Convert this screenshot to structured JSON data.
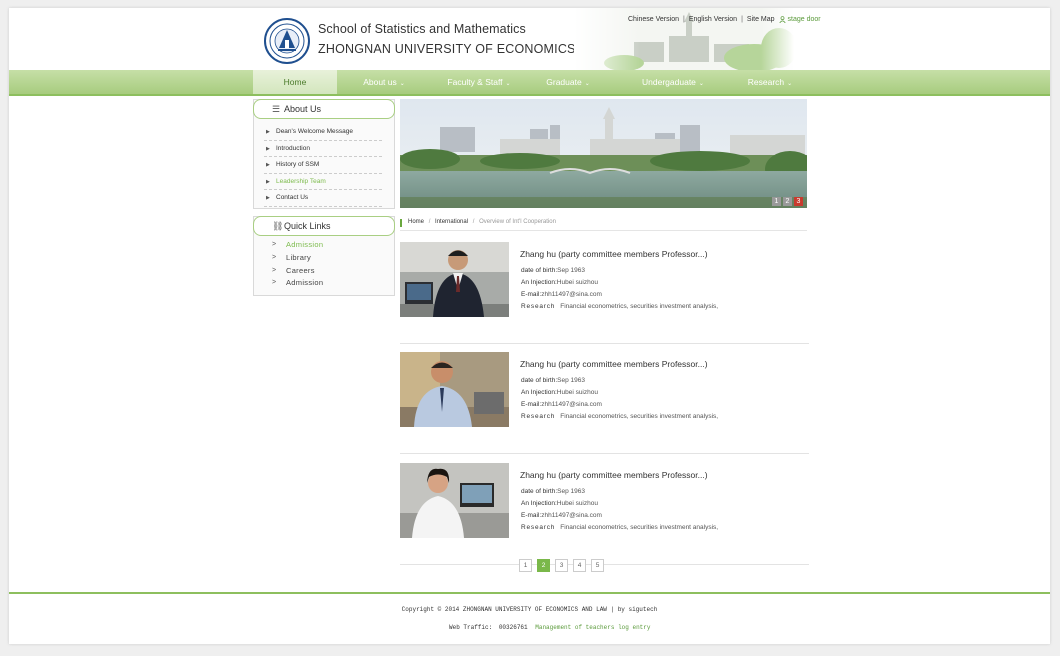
{
  "header": {
    "school": "School of Statistics and Mathematics",
    "university": "ZHONGNAN UNIVERSITY OF ECONOMICS AND LAW",
    "toplinks": [
      "Chinese Version",
      "English Version",
      "Site Map"
    ],
    "stage_door": "stage door"
  },
  "nav": {
    "items": [
      {
        "label": "Home"
      },
      {
        "label": "About us"
      },
      {
        "label": "Faculty & Staff"
      },
      {
        "label": "Graduate"
      },
      {
        "label": "Undergaduate"
      },
      {
        "label": "Research"
      }
    ],
    "caret": "⌄"
  },
  "sidebar": {
    "about_title": "About Us",
    "about_items": [
      {
        "label": "Dean's Welcome Message"
      },
      {
        "label": "Introduction"
      },
      {
        "label": "History of SSM"
      },
      {
        "label": "Leadership Team"
      },
      {
        "label": "Contact Us"
      }
    ],
    "quick_title": "Quick Links",
    "quick_items": [
      {
        "label": "Admission"
      },
      {
        "label": "Library"
      },
      {
        "label": "Careers"
      },
      {
        "label": "Admission"
      }
    ]
  },
  "banner": {
    "dots": [
      "1",
      "2",
      "3"
    ],
    "active_dot": "3"
  },
  "breadcrumb": {
    "home": "Home",
    "section": "International",
    "current": "Overview of Int'l Cooperation",
    "sep": "/"
  },
  "people": [
    {
      "name": "Zhang hu (party committee members Professor...)",
      "dob_label": "date of birth:",
      "dob": "Sep 1963",
      "inj_label": "An Injection:",
      "inj": "Hubei suizhou",
      "email_label": "E-mail:",
      "email": "zhh11497@sina.com",
      "research_label": "Research",
      "research": "Financial econometrics, securities investment analysis,"
    },
    {
      "name": "Zhang hu (party committee members Professor...)",
      "dob_label": "date of birth:",
      "dob": "Sep 1963",
      "inj_label": "An Injection:",
      "inj": "Hubei suizhou",
      "email_label": "E-mail:",
      "email": "zhh11497@sina.com",
      "research_label": "Research",
      "research": "Financial econometrics, securities investment analysis,"
    },
    {
      "name": "Zhang hu (party committee members Professor...)",
      "dob_label": "date of birth:",
      "dob": "Sep 1963",
      "inj_label": "An Injection:",
      "inj": "Hubei suizhou",
      "email_label": "E-mail:",
      "email": "zhh11497@sina.com",
      "research_label": "Research",
      "research": "Financial econometrics, securities investment analysis,"
    }
  ],
  "pager": {
    "pages": [
      "1",
      "2",
      "3",
      "4",
      "5"
    ],
    "current": "2"
  },
  "footer": {
    "copyright": "Copyright © 2014 ZHONGNAN UNIVERSITY OF ECONOMICS AND LAW | by sigutech",
    "traffic_label": "Web Traffic:",
    "traffic_count": "00326761",
    "login_link": "Management of teachers log entry"
  },
  "colors": {
    "accent": "#8dbf5e",
    "active_link": "#7dbb4d",
    "active_dot": "#c83a2e"
  }
}
